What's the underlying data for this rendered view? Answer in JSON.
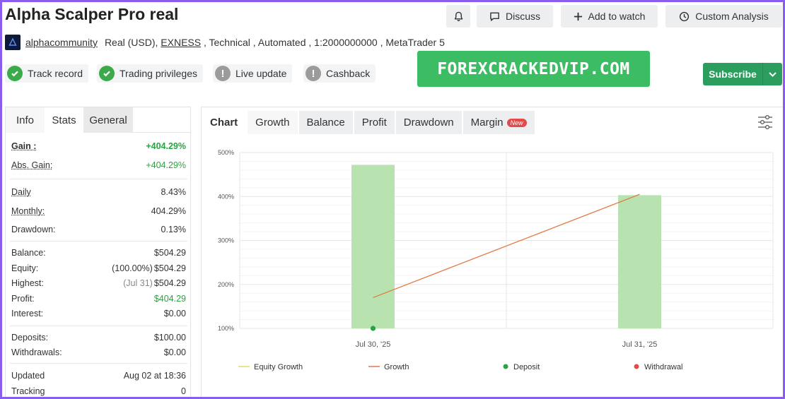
{
  "header": {
    "title": "Alpha Scalper Pro real",
    "buttons": {
      "discuss": "Discuss",
      "watch": "Add to watch",
      "custom": "Custom Analysis"
    },
    "author": "alphacommunity",
    "meta_prefix": "Real (USD), ",
    "broker": "EXNESS",
    "meta_suffix": " , Technical , Automated , 1:2000000000 , MetaTrader 5"
  },
  "badges": [
    {
      "label": "Track record",
      "status": "ok"
    },
    {
      "label": "Trading privileges",
      "status": "ok"
    },
    {
      "label": "Live update",
      "status": "warn"
    },
    {
      "label": "Cashback",
      "status": "warn"
    }
  ],
  "watermark": "FOREXCRACKEDVIP.COM",
  "subscribe_label": "Subscribe",
  "left_tabs": [
    "Info",
    "Stats",
    "General"
  ],
  "stats": [
    {
      "label": "Gain :",
      "value": "+404.29%"
    },
    {
      "label": "Abs. Gain:",
      "value": "+404.29%"
    },
    {
      "label": "Daily",
      "value": "8.43%"
    },
    {
      "label": "Monthly:",
      "value": "404.29%"
    },
    {
      "label": "Drawdown:",
      "value": "0.13%"
    },
    {
      "label": "Balance:",
      "value": "$504.29"
    },
    {
      "label": "Equity:",
      "prefix": "(100.00%)",
      "value": "$504.29"
    },
    {
      "label": "Highest:",
      "prefix": "(Jul 31)",
      "value": "$504.29"
    },
    {
      "label": "Profit:",
      "value": "$404.29"
    },
    {
      "label": "Interest:",
      "value": "$0.00"
    },
    {
      "label": "Deposits:",
      "value": "$100.00"
    },
    {
      "label": "Withdrawals:",
      "value": "$0.00"
    },
    {
      "label": "Updated",
      "value": "Aug 02 at 18:36"
    },
    {
      "label": "Tracking",
      "value": "0"
    }
  ],
  "chart_tabs": {
    "label": "Chart",
    "tabs": [
      "Growth",
      "Balance",
      "Profit",
      "Drawdown",
      "Margin"
    ],
    "new_badge": "New"
  },
  "colors": {
    "bar": "#b8e3b1",
    "growth_line": "#e07a3f",
    "equity_line": "#e8d56a",
    "deposit": "#2aa243",
    "withdrawal": "#e44a4a"
  },
  "chart_data": {
    "type": "bar",
    "categories": [
      "Jul 30, '25",
      "Jul 31, '25"
    ],
    "y_ticks": [
      "500%",
      "400%",
      "300%",
      "200%",
      "100%"
    ],
    "ylim": [
      100,
      500
    ],
    "series": [
      {
        "name": "Equity Growth",
        "type": "line",
        "values": []
      },
      {
        "name": "Growth",
        "type": "line",
        "values": [
          170,
          405
        ]
      },
      {
        "name": "Growth",
        "type": "bar",
        "values": [
          472,
          403
        ]
      },
      {
        "name": "Deposit",
        "type": "point",
        "values": [
          100,
          null
        ]
      },
      {
        "name": "Withdrawal",
        "type": "point",
        "values": []
      }
    ],
    "legend": [
      "Equity Growth",
      "Growth",
      "Deposit",
      "Withdrawal"
    ],
    "grid": true
  }
}
